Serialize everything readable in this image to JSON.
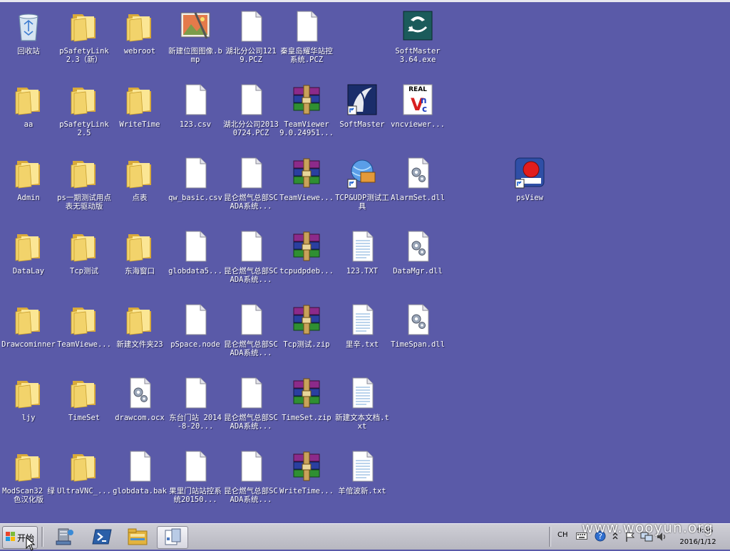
{
  "desktop": {
    "columns": [
      [
        {
          "label": "回收站",
          "type": "recycle"
        },
        {
          "label": "aa",
          "type": "folder"
        },
        {
          "label": "Admin",
          "type": "folder"
        },
        {
          "label": "DataLay",
          "type": "folder"
        },
        {
          "label": "Drawcominner",
          "type": "folder"
        },
        {
          "label": "ljy",
          "type": "folder"
        },
        {
          "label": "ModScan32 绿色汉化版",
          "type": "folder"
        }
      ],
      [
        {
          "label": "pSafetyLink 2.3（新）",
          "type": "folder"
        },
        {
          "label": "pSafetyLink 2.5",
          "type": "folder"
        },
        {
          "label": "ps一期测试用点表无驱动版",
          "type": "folder"
        },
        {
          "label": "Tcp测试",
          "type": "folder"
        },
        {
          "label": "TeamViewe...",
          "type": "folder"
        },
        {
          "label": "TimeSet",
          "type": "folder"
        },
        {
          "label": "UltraVNC_...",
          "type": "folder"
        }
      ],
      [
        {
          "label": "webroot",
          "type": "folder"
        },
        {
          "label": "WriteTime",
          "type": "folder"
        },
        {
          "label": "点表",
          "type": "folder"
        },
        {
          "label": "东海窗口",
          "type": "folder"
        },
        {
          "label": "新建文件夹23",
          "type": "folder"
        },
        {
          "label": "drawcom.ocx",
          "type": "dll"
        },
        {
          "label": "globdata.bak",
          "type": "file"
        }
      ],
      [
        {
          "label": "新建位图图像.bmp",
          "type": "bmp"
        },
        {
          "label": "123.csv",
          "type": "file"
        },
        {
          "label": "qw_basic.csv",
          "type": "file"
        },
        {
          "label": "globdata5...",
          "type": "file"
        },
        {
          "label": "pSpace.node",
          "type": "file"
        },
        {
          "label": "东台门站 2014-8-20...",
          "type": "file"
        },
        {
          "label": "果里门站站控系统20150...",
          "type": "file"
        }
      ],
      [
        {
          "label": "湖北分公司1219.PCZ",
          "type": "file"
        },
        {
          "label": "湖北分公司20130724.PCZ",
          "type": "file"
        },
        {
          "label": "昆仑燃气总部SCADA系统...",
          "type": "file"
        },
        {
          "label": "昆仑燃气总部SCADA系统...",
          "type": "file"
        },
        {
          "label": "昆仑燃气总部SCADA系统...",
          "type": "file"
        },
        {
          "label": "昆仑燃气总部SCADA系统...",
          "type": "file"
        },
        {
          "label": "昆仑燃气总部SCADA系统...",
          "type": "file"
        }
      ],
      [
        {
          "label": "秦皇岛耀华站控系统.PCZ",
          "type": "file"
        },
        {
          "label": "TeamViewer 9.0.24951...",
          "type": "rar"
        },
        {
          "label": "TeamViewe...",
          "type": "rar"
        },
        {
          "label": "tcpudpdeb...",
          "type": "rar"
        },
        {
          "label": "Tcp测试.zip",
          "type": "rar"
        },
        {
          "label": "TimeSet.zip",
          "type": "rar"
        },
        {
          "label": "WriteTime...",
          "type": "rar"
        }
      ],
      [
        {
          "label": "",
          "type": "empty"
        },
        {
          "label": "SoftMaster",
          "type": "softmaster-shortcut"
        },
        {
          "label": "TCP&UDP测试工具",
          "type": "tcpudp"
        },
        {
          "label": "123.TXT",
          "type": "txt"
        },
        {
          "label": "里辛.txt",
          "type": "txt"
        },
        {
          "label": "新建文本文档.txt",
          "type": "txt"
        },
        {
          "label": "羊倌波新.txt",
          "type": "txt"
        }
      ],
      [
        {
          "label": "SoftMaster 3.64.exe",
          "type": "softmaster-exe"
        },
        {
          "label": "vncviewer...",
          "type": "vnc"
        },
        {
          "label": "AlarmSet.dll",
          "type": "dll"
        },
        {
          "label": "DataMgr.dll",
          "type": "dll"
        },
        {
          "label": "TimeSpan.dll",
          "type": "dll"
        },
        {
          "label": "",
          "type": "empty"
        },
        {
          "label": "",
          "type": "empty"
        }
      ],
      [
        {
          "label": "",
          "type": "empty"
        },
        {
          "label": "",
          "type": "empty"
        },
        {
          "label": "psView",
          "type": "psview"
        },
        {
          "label": "",
          "type": "empty"
        },
        {
          "label": "",
          "type": "empty"
        },
        {
          "label": "",
          "type": "empty"
        },
        {
          "label": "",
          "type": "empty"
        }
      ]
    ]
  },
  "taskbar": {
    "start_label": "开始",
    "tray": {
      "language": "CH",
      "time": "9:56",
      "date": "2016/1/12"
    }
  },
  "watermark": "www.wooyun.org",
  "colors": {
    "desktop": "#5a5aa8",
    "folder": "#f2d36b",
    "folder_dark": "#d9aa3a"
  }
}
